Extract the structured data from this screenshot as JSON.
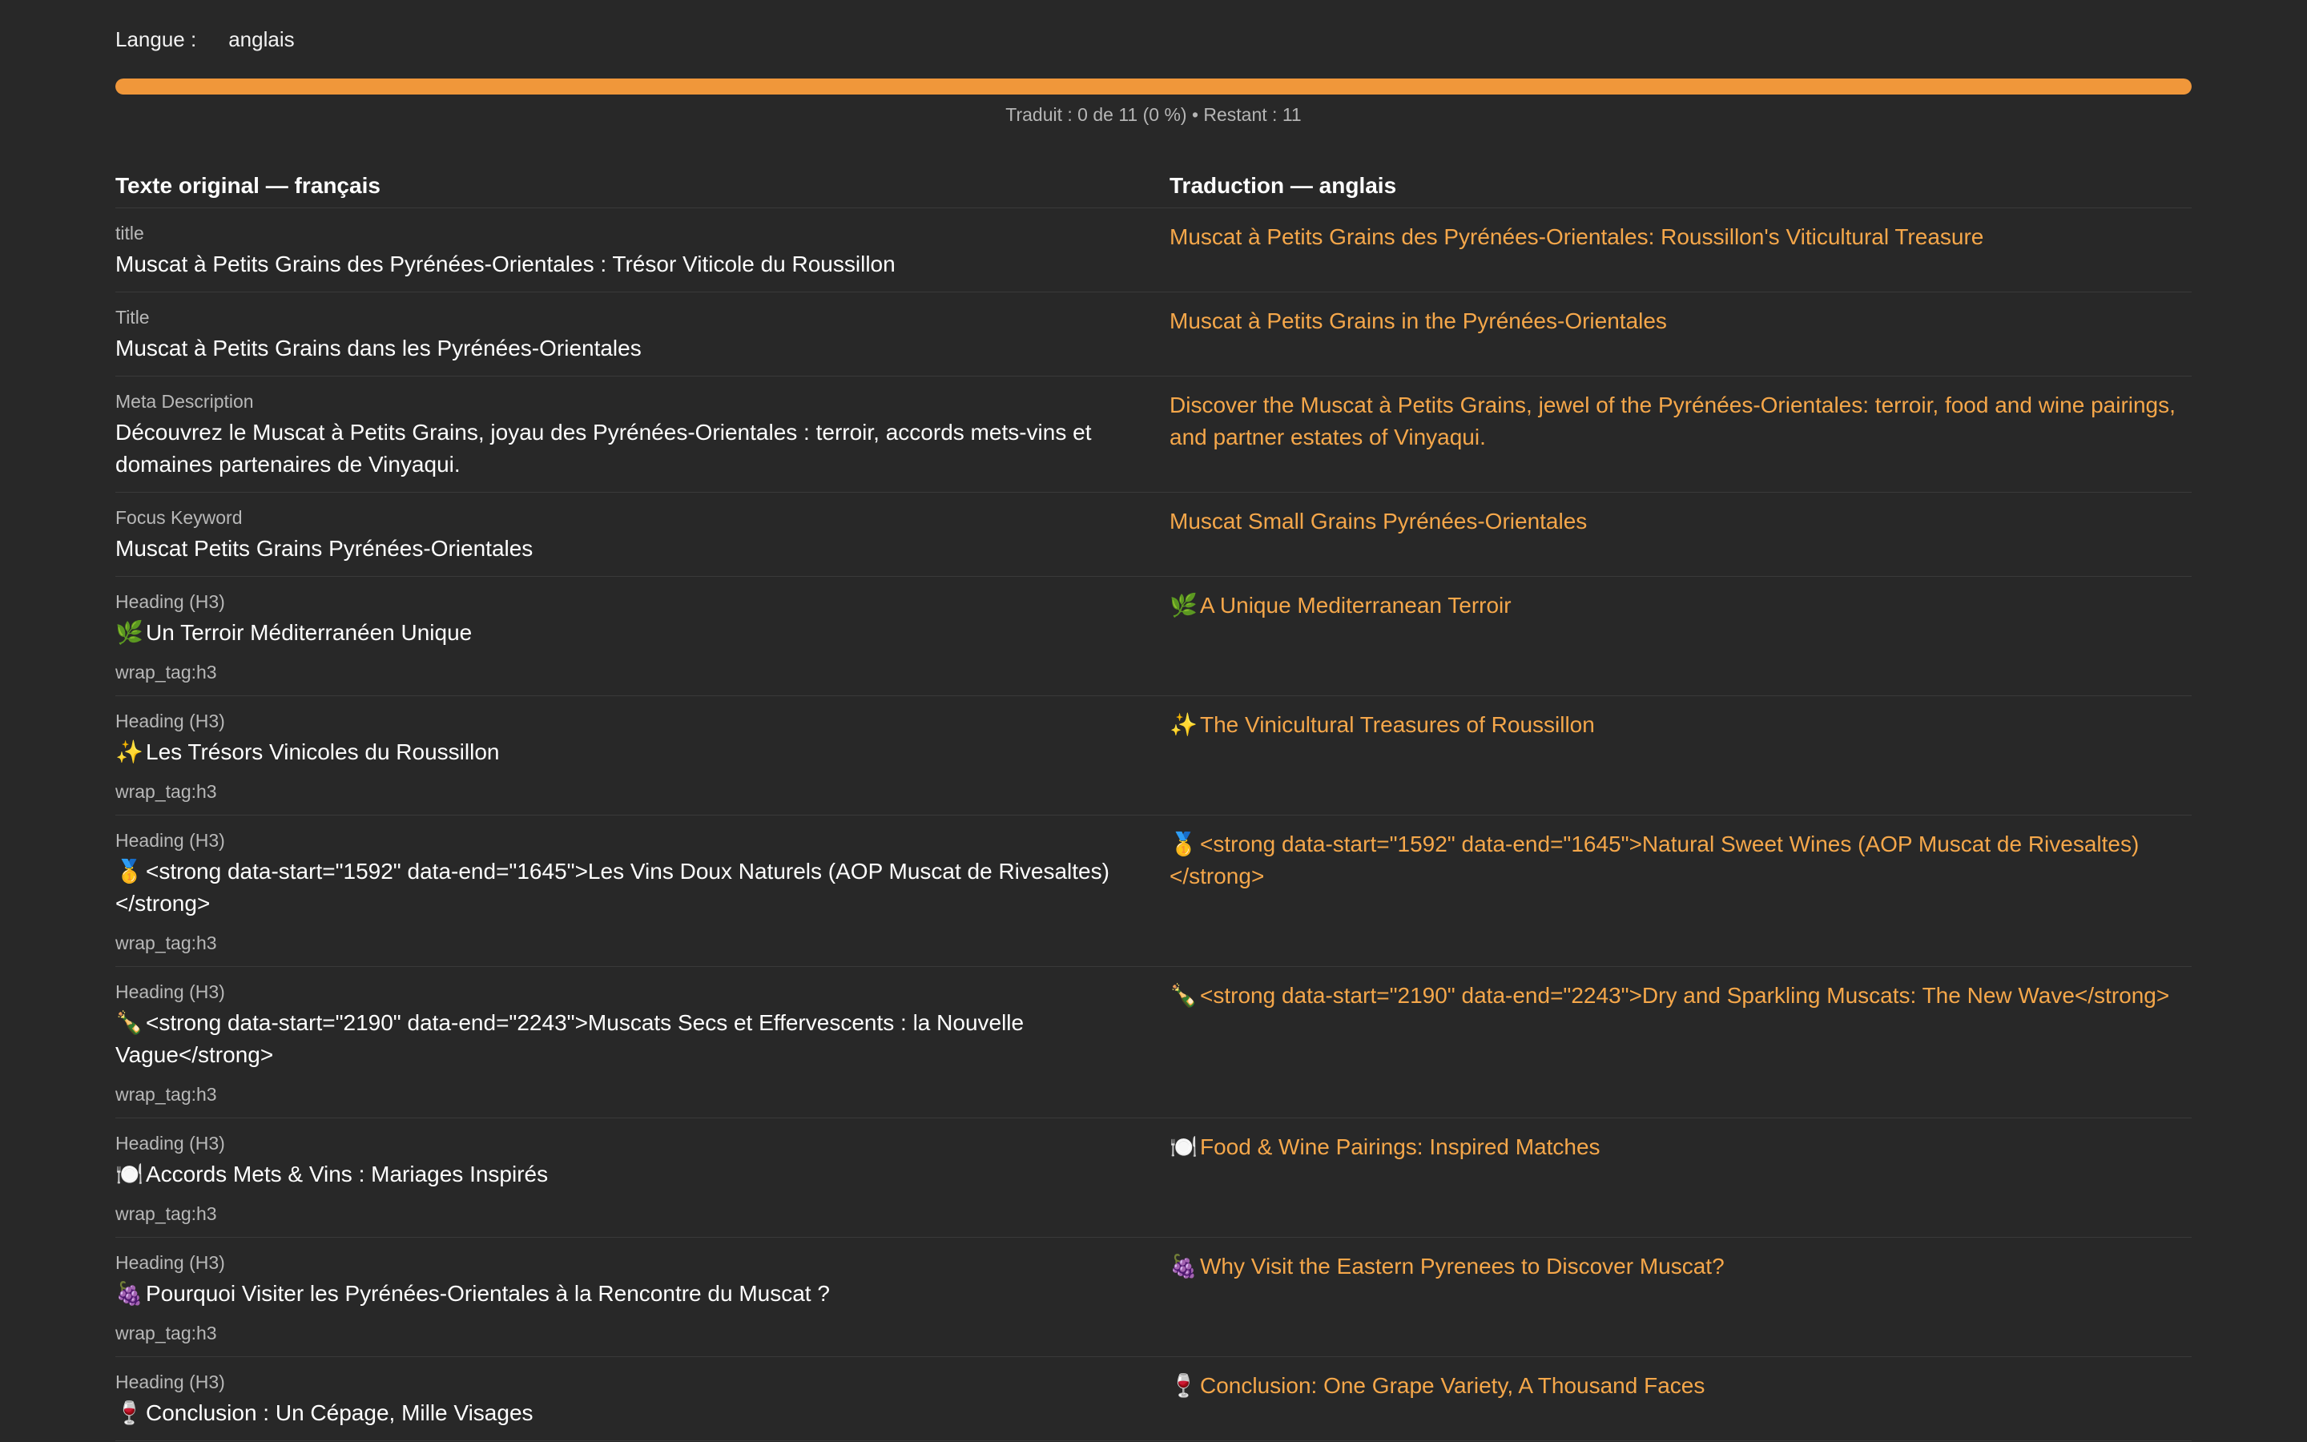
{
  "header": {
    "language_label": "Langue :",
    "language_value": "anglais",
    "progress_fraction": 0.0,
    "progress_text": "Traduit : 0 de 11 (0 %) • Restant : 11"
  },
  "table": {
    "col_original": "Texte original — français",
    "col_translation": "Traduction — anglais",
    "rows": [
      {
        "label": "title",
        "emoji": "",
        "original": "Muscat à Petits Grains des Pyrénées-Orientales : Trésor Viticole du Roussillon",
        "tag": "",
        "translation": "Muscat à Petits Grains des Pyrénées-Orientales: Roussillon's Viticultural Treasure"
      },
      {
        "label": "Title",
        "emoji": "",
        "original": "Muscat à Petits Grains dans les Pyrénées-Orientales",
        "tag": "",
        "translation": "Muscat à Petits Grains in the Pyrénées-Orientales"
      },
      {
        "label": "Meta Description",
        "emoji": "",
        "original": "Découvrez le Muscat à Petits Grains, joyau des Pyrénées-Orientales : terroir, accords mets-vins et domaines partenaires de Vinyaqui.",
        "tag": "",
        "translation": "Discover the Muscat à Petits Grains, jewel of the Pyrénées-Orientales: terroir, food and wine pairings, and partner estates of Vinyaqui."
      },
      {
        "label": "Focus Keyword",
        "emoji": "",
        "original": "Muscat Petits Grains Pyrénées-Orientales",
        "tag": "",
        "translation": "Muscat Small Grains Pyrénées-Orientales"
      },
      {
        "label": "Heading (H3)",
        "emoji": "🌿",
        "original": "Un Terroir Méditerranéen Unique",
        "tag": "wrap_tag:h3",
        "translation": "A Unique Mediterranean Terroir"
      },
      {
        "label": "Heading (H3)",
        "emoji": "✨",
        "original": "Les Trésors Vinicoles du Roussillon",
        "tag": "wrap_tag:h3",
        "translation": "The Vinicultural Treasures of Roussillon"
      },
      {
        "label": "Heading (H3)",
        "emoji": "🥇",
        "original": "<strong data-start=\"1592\" data-end=\"1645\">Les Vins Doux Naturels (AOP Muscat de Rivesaltes)</strong>",
        "tag": "wrap_tag:h3",
        "translation": "<strong data-start=\"1592\" data-end=\"1645\">Natural Sweet Wines (AOP Muscat de Rivesaltes)</strong>"
      },
      {
        "label": "Heading (H3)",
        "emoji": "🍾",
        "original": "<strong data-start=\"2190\" data-end=\"2243\">Muscats Secs et Effervescents : la Nouvelle Vague</strong>",
        "tag": "wrap_tag:h3",
        "translation": "<strong data-start=\"2190\" data-end=\"2243\">Dry and Sparkling Muscats: The New Wave</strong>"
      },
      {
        "label": "Heading (H3)",
        "emoji": "🍽️",
        "original": "Accords Mets & Vins : Mariages Inspirés",
        "tag": "wrap_tag:h3",
        "translation": "Food & Wine Pairings: Inspired Matches"
      },
      {
        "label": "Heading (H3)",
        "emoji": "🍇",
        "original": "Pourquoi Visiter les Pyrénées-Orientales à la Rencontre du Muscat ?",
        "tag": "wrap_tag:h3",
        "translation": "Why Visit the Eastern Pyrenees to Discover Muscat?"
      },
      {
        "label": "Heading (H3)",
        "emoji": "🍷",
        "original": "Conclusion : Un Cépage, Mille Visages",
        "tag": "",
        "translation": "Conclusion: One Grape Variety, A Thousand Faces"
      }
    ]
  }
}
